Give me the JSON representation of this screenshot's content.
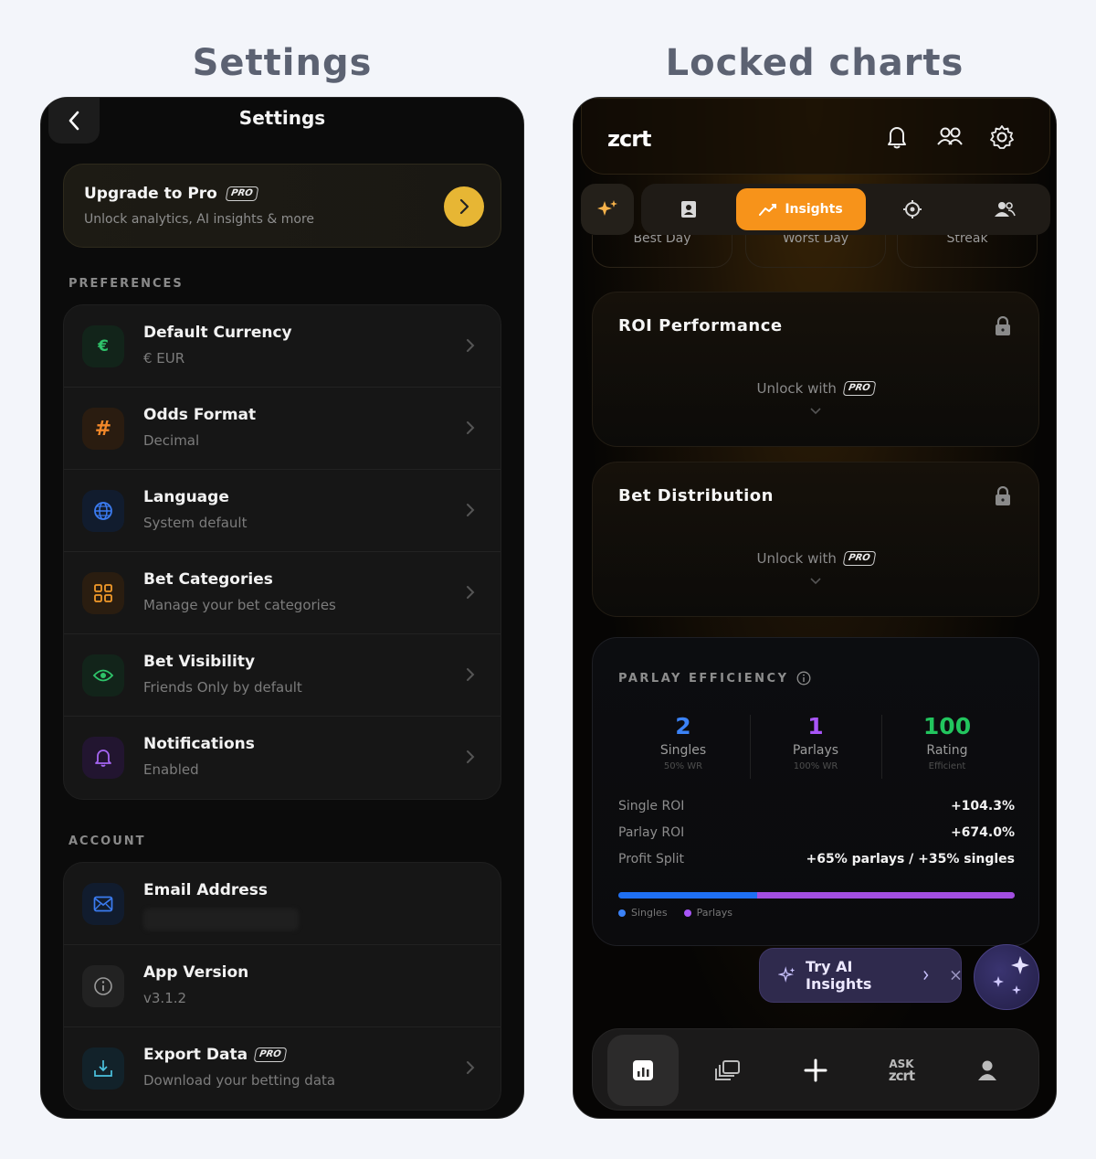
{
  "captions": {
    "left": "Settings",
    "right": "Locked charts"
  },
  "settings": {
    "title": "Settings",
    "upgrade": {
      "title": "Upgrade to Pro",
      "badge": "PRO",
      "subtitle": "Unlock analytics, AI insights & more"
    },
    "preferences_label": "PREFERENCES",
    "preferences": [
      {
        "label": "Default Currency",
        "value": "€ EUR",
        "icon": "euro-icon",
        "glyph": "€",
        "color": "#2fc46a"
      },
      {
        "label": "Odds Format",
        "value": "Decimal",
        "icon": "hash-icon",
        "glyph": "#",
        "color": "#f2882a"
      },
      {
        "label": "Language",
        "value": "System default",
        "icon": "globe-icon",
        "color": "#3b7bf0"
      },
      {
        "label": "Bet Categories",
        "value": "Manage your bet categories",
        "icon": "grid-icon",
        "color": "#f29a2a"
      },
      {
        "label": "Bet Visibility",
        "value": "Friends Only by default",
        "icon": "eye-icon",
        "color": "#2fc46a"
      },
      {
        "label": "Notifications",
        "value": "Enabled",
        "icon": "bell-icon",
        "color": "#a565f2"
      }
    ],
    "account_label": "ACCOUNT",
    "account": [
      {
        "label": "Email Address",
        "value": "",
        "icon": "mail-icon"
      },
      {
        "label": "App Version",
        "value": "v3.1.2",
        "icon": "info-icon"
      },
      {
        "label": "Export Data",
        "badge": "PRO",
        "value": "Download your betting data",
        "icon": "download-icon"
      }
    ]
  },
  "insights": {
    "logo": "zcrt",
    "active_tab": "Insights",
    "pill_tabs": [
      "Best Day",
      "Worst Day",
      "Streak"
    ],
    "locked_cards": [
      {
        "title": "ROI Performance",
        "unlock_text": "Unlock with",
        "badge": "PRO"
      },
      {
        "title": "Bet Distribution",
        "unlock_text": "Unlock with",
        "badge": "PRO"
      }
    ],
    "parlay": {
      "heading": "PARLAY EFFICIENCY",
      "stats": [
        {
          "value": "2",
          "label": "Singles",
          "sub": "50% WR",
          "color": "#3b82f6"
        },
        {
          "value": "1",
          "label": "Parlays",
          "sub": "100% WR",
          "color": "#a855f7"
        },
        {
          "value": "100",
          "label": "Rating",
          "sub": "Efficient",
          "color": "#22c55e"
        }
      ],
      "rows": [
        {
          "key": "Single ROI",
          "value": "+104.3%"
        },
        {
          "key": "Parlay ROI",
          "value": "+674.0%"
        },
        {
          "key": "Profit Split",
          "value": "+65% parlays / +35% singles"
        }
      ],
      "split": {
        "singles_pct": 35,
        "parlays_pct": 65,
        "singles_color": "#1f6ff2",
        "parlays_color": "#a24ee0"
      },
      "legend": [
        "Singles",
        "Parlays"
      ]
    },
    "ai_pill": "Try AI Insights",
    "nav_ask": {
      "top": "ASK",
      "bottom": "zcrt"
    }
  }
}
